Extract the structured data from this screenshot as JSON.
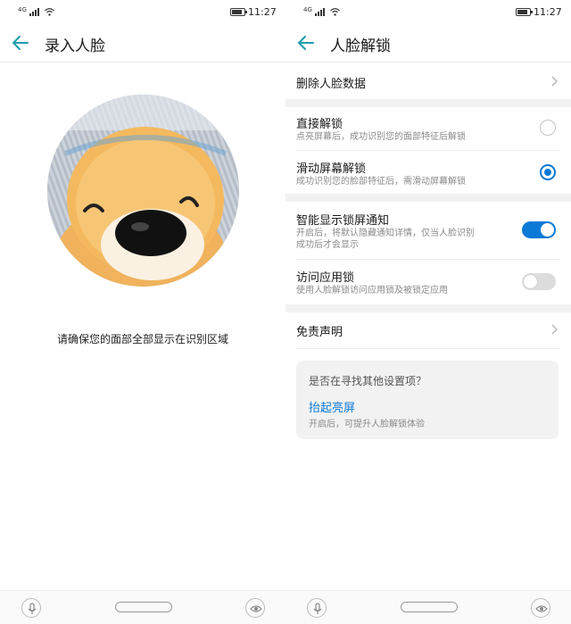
{
  "status": {
    "signal_label": "4G",
    "clock": "11:27",
    "battery_level": 0.85
  },
  "left": {
    "title": "录入人脸",
    "hint": "请确保您的面部全部显示在识别区域"
  },
  "right": {
    "title": "人脸解锁",
    "delete_face": {
      "label": "删除人脸数据"
    },
    "unlock_options": [
      {
        "title": "直接解锁",
        "subtitle": "点亮屏幕后，成功识别您的面部特征后解锁",
        "selected": false
      },
      {
        "title": "滑动屏幕解锁",
        "subtitle": "成功识别您的脸部特征后，需滑动屏幕解锁",
        "selected": true
      }
    ],
    "smart_notify": {
      "title": "智能显示锁屏通知",
      "subtitle_line1": "开启后，将默认隐藏通知详情，仅当人脸识别",
      "subtitle_line2": "成功后才会显示",
      "enabled": true
    },
    "app_lock": {
      "title": "访问应用锁",
      "subtitle": "使用人脸解锁访问应用锁及被锁定应用",
      "enabled": false
    },
    "disclaimer": {
      "label": "免责声明"
    },
    "suggest": {
      "question": "是否在寻找其他设置项？",
      "link": "抬起亮屏",
      "desc": "开启后，可提升人脸解锁体验"
    }
  },
  "colors": {
    "accent": "#0a7ad6",
    "icon_teal": "#1f9bb0",
    "section_gap": "#f2f2f2"
  },
  "icons": [
    "back-arrow-icon",
    "chevron-right-icon",
    "mic-icon",
    "eye-icon",
    "wifi-icon",
    "battery-icon"
  ]
}
